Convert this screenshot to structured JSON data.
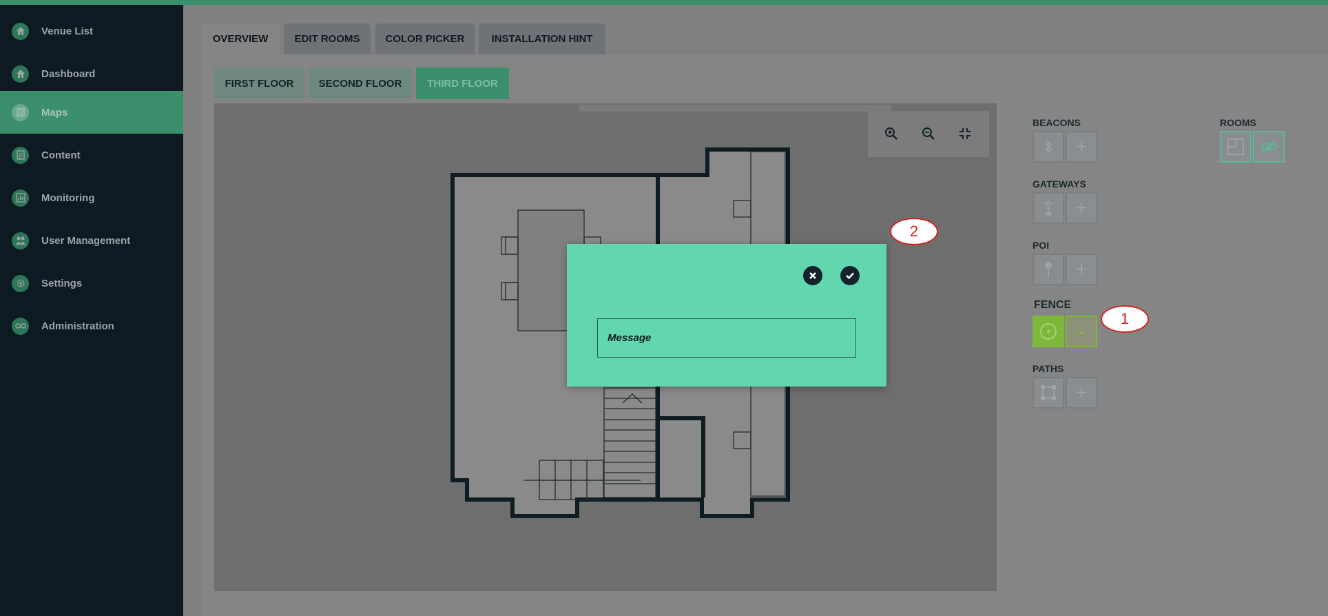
{
  "sidebar": {
    "items": [
      {
        "label": "Venue List",
        "icon": "home-icon"
      },
      {
        "label": "Dashboard",
        "icon": "home-icon"
      },
      {
        "label": "Maps",
        "icon": "map-icon",
        "active": true
      },
      {
        "label": "Content",
        "icon": "document-icon"
      },
      {
        "label": "Monitoring",
        "icon": "chart-icon"
      },
      {
        "label": "User Management",
        "icon": "users-icon"
      },
      {
        "label": "Settings",
        "icon": "gear-icon"
      },
      {
        "label": "Administration",
        "icon": "infinity-icon"
      }
    ]
  },
  "tabs": [
    {
      "label": "OVERVIEW",
      "active": true
    },
    {
      "label": "EDIT ROOMS"
    },
    {
      "label": "COLOR PICKER"
    },
    {
      "label": "INSTALLATION HINT"
    }
  ],
  "floors": [
    {
      "label": "FIRST FLOOR"
    },
    {
      "label": "SECOND FLOOR"
    },
    {
      "label": "THIRD FLOOR",
      "active": true
    }
  ],
  "tools": {
    "beacons_label": "BEACONS",
    "gateways_label": "GATEWAYS",
    "poi_label": "POI",
    "fence_label": "FENCE",
    "fence_minus": "-",
    "paths_label": "PATHS",
    "rooms_label": "ROOMS",
    "plus_symbol": "+"
  },
  "modal": {
    "message_placeholder": "Message"
  },
  "callouts": {
    "one": "1",
    "two": "2"
  },
  "colors": {
    "accent": "#3b8f6c",
    "modal_bg": "#62d6ae",
    "fence_active": "#7db83a",
    "callout_red": "#d8221d",
    "sidebar_bg": "#0d1a22"
  }
}
